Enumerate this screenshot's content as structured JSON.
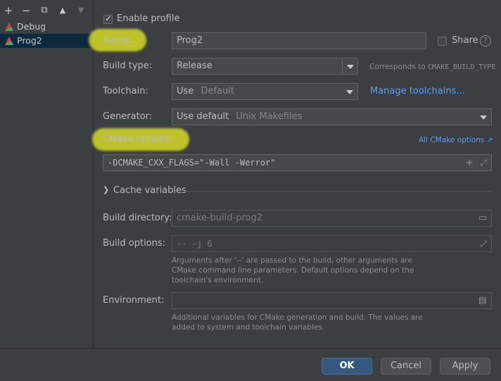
{
  "toolbar": {
    "add_icon": "+",
    "remove_icon": "−",
    "copy_icon": "⧉",
    "up_icon": "▲",
    "down_icon": "▼"
  },
  "configurations": [
    {
      "label": "Debug",
      "selected": false
    },
    {
      "label": "Prog2",
      "selected": true
    }
  ],
  "form": {
    "enable_profile": "Enable profile",
    "name_label": "Name:",
    "name_value": "Prog2",
    "share_label": "Share",
    "help_icon": "?",
    "build_type_label": "Build type:",
    "build_type_value": "Release",
    "build_type_note_prefix": "Corresponds to ",
    "build_type_note_code": "CMAKE_BUILD_TYPE",
    "toolchain_label": "Toolchain:",
    "toolchain_value": "Use",
    "toolchain_hint": "Default",
    "manage_toolchains": "Manage toolchains...",
    "generator_label": "Generator:",
    "generator_value": "Use default",
    "generator_hint": "Unix Makefiles",
    "cmake_options_label": "CMake options:",
    "all_cmake_options": "All CMake options ↗",
    "cmake_options_value": "-DCMAKE_CXX_FLAGS=\"-Wall -Werror\"",
    "cache_variables": "Cache variables",
    "build_dir_label": "Build directory:",
    "build_dir_placeholder": "cmake-build-prog2",
    "build_options_label": "Build options:",
    "build_options_placeholder": "-- -j 6",
    "build_options_note_1": "Arguments after '--' are passed to the build, other arguments are",
    "build_options_note_2": "CMake command line parameters. Default options depend on the",
    "build_options_note_3": "toolchain's environment.",
    "environment_label": "Environment:",
    "environment_note_1": "Additional variables for CMake generation and build. The values are",
    "environment_note_2": "added to system and toolchain variables."
  },
  "buttons": {
    "ok": "OK",
    "cancel": "Cancel",
    "apply": "Apply"
  },
  "colors": {
    "highlight": "#dae028",
    "link": "#589df6",
    "selection": "#0d293e",
    "primary_button": "#365880"
  }
}
